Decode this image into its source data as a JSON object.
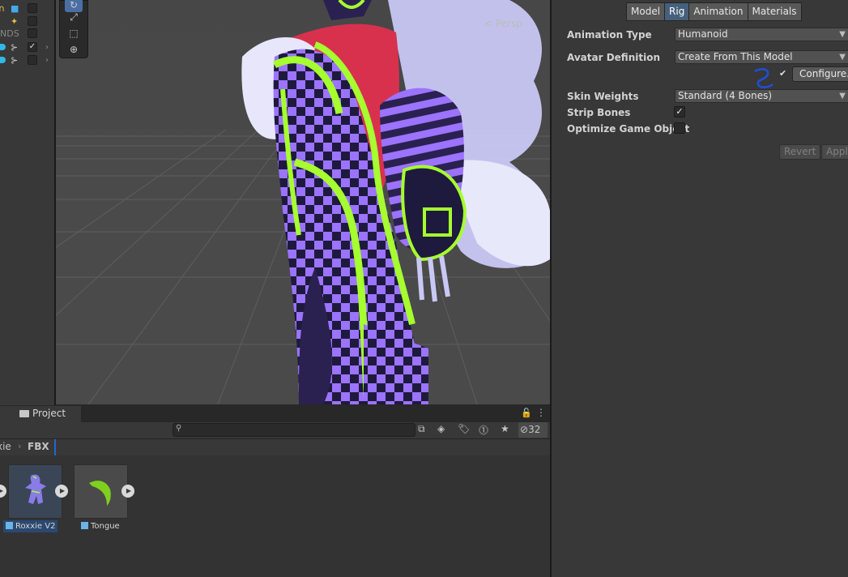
{
  "hierarchy": {
    "truncated_label": "NDS"
  },
  "scene": {
    "camera_mode": "< Persp"
  },
  "inspector": {
    "tabs": [
      "Model",
      "Rig",
      "Animation",
      "Materials"
    ],
    "active_tab": "Rig",
    "animation_type_label": "Animation Type",
    "animation_type_value": "Humanoid",
    "avatar_definition_label": "Avatar Definition",
    "avatar_definition_value": "Create From This Model",
    "configure_button": "Configure...",
    "skin_weights_label": "Skin Weights",
    "skin_weights_value": "Standard (4 Bones)",
    "strip_bones_label": "Strip Bones",
    "strip_bones_checked": true,
    "optimize_label": "Optimize Game Object",
    "optimize_checked": false,
    "revert_button": "Revert",
    "apply_button": "Apply"
  },
  "project": {
    "tab_title": "Project",
    "search_placeholder": "",
    "hidden_count": "32",
    "breadcrumb": [
      "xie",
      "FBX"
    ],
    "assets": [
      {
        "name": "Roxxie V2",
        "selected": true
      },
      {
        "name": "Tongue",
        "selected": false
      }
    ]
  },
  "colors": {
    "accent_blue": "#46607c",
    "neon_green": "#a6ff2e",
    "purple": "#9b73ff",
    "red": "#d8314e"
  }
}
